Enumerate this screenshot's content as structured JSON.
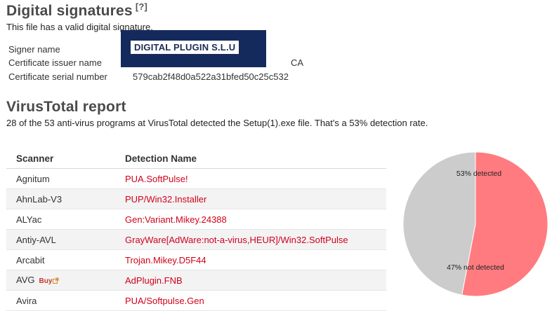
{
  "signatures": {
    "title": "Digital signatures",
    "help": "[?]",
    "status": "This file has a valid digital signature.",
    "rows": [
      {
        "label": "Signer name",
        "value": "DIGITAL PLUGIN S.L.U"
      },
      {
        "label": "Certificate issuer name",
        "value": "CA"
      },
      {
        "label": "Certificate serial number",
        "value": "579cab2f48d0a522a31bfed50c25c532"
      }
    ]
  },
  "report": {
    "title": "VirusTotal report",
    "summary": "28 of the 53 anti-virus programs at VirusTotal detected the Setup(1).exe file. That's a 53% detection rate.",
    "columns": [
      "Scanner",
      "Detection Name"
    ],
    "rows": [
      {
        "scanner": "Agnitum",
        "detection": "PUA.SoftPulse!"
      },
      {
        "scanner": "AhnLab-V3",
        "detection": "PUP/Win32.Installer"
      },
      {
        "scanner": "ALYac",
        "detection": "Gen:Variant.Mikey.24388"
      },
      {
        "scanner": "Antiy-AVL",
        "detection": "GrayWare[AdWare:not-a-virus,HEUR]/Win32.SoftPulse"
      },
      {
        "scanner": "Arcabit",
        "detection": "Trojan.Mikey.D5F44"
      },
      {
        "scanner": "AVG",
        "detection": "AdPlugin.FNB",
        "buy": "Buy"
      },
      {
        "scanner": "Avira",
        "detection": "PUA/Softpulse.Gen"
      }
    ]
  },
  "chart_data": {
    "type": "pie",
    "slices": [
      {
        "label": "53% detected",
        "value": 53,
        "color": "#ff7b7f"
      },
      {
        "label": "47% not detected",
        "value": 47,
        "color": "#cccccc"
      }
    ]
  },
  "icons": {
    "external_link": "external-link-icon"
  }
}
